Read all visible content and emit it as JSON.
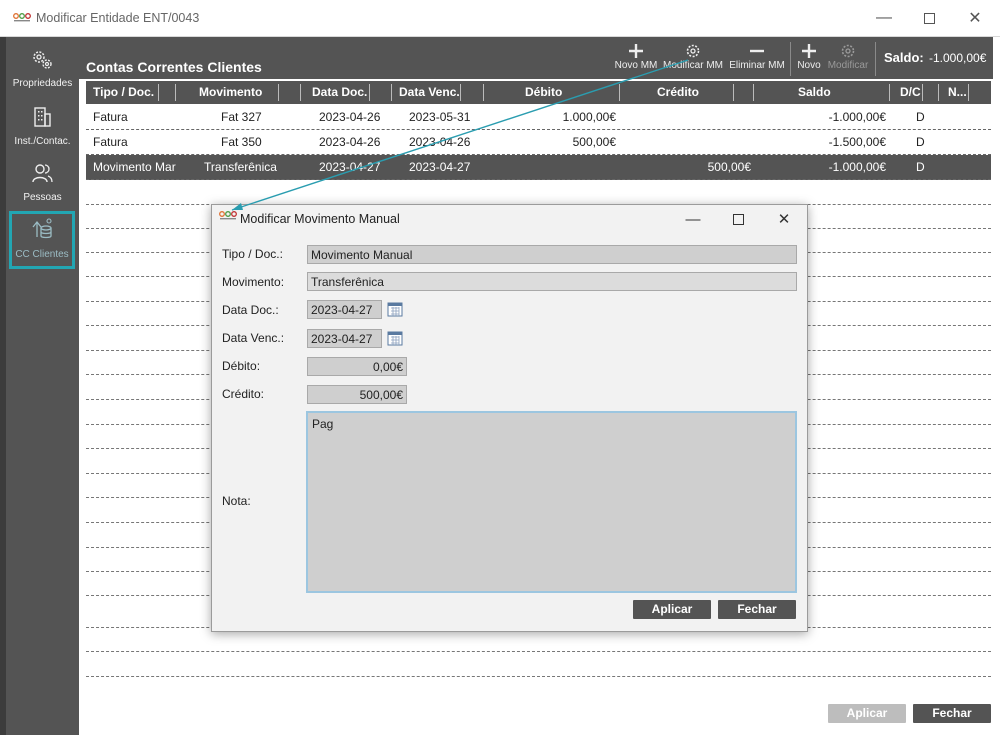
{
  "window": {
    "title": "Modificar Entidade ENT/0043"
  },
  "sidebar": {
    "items": [
      {
        "label": "Propriedades",
        "icon": "gears-icon"
      },
      {
        "label": "Inst./Contac.",
        "icon": "building-icon"
      },
      {
        "label": "Pessoas",
        "icon": "people-icon"
      },
      {
        "label": "CC Clientes",
        "icon": "coins-icon",
        "active": true
      }
    ]
  },
  "panel": {
    "title": "Contas Correntes Clientes",
    "toolbar": {
      "novo_mm": "Novo MM",
      "modificar_mm": "Modificar MM",
      "eliminar_mm": "Eliminar MM",
      "novo": "Novo",
      "modificar": "Modificar"
    },
    "saldo_label": "Saldo:",
    "saldo_value": "-1.000,00€"
  },
  "table": {
    "columns": [
      "Tipo / Doc.",
      "Movimento",
      "Data Doc.",
      "Data Venc.",
      "Débito",
      "Crédito",
      "Saldo",
      "D/C",
      "N..."
    ],
    "rows": [
      {
        "tipo": "Fatura",
        "movimento": "Fat 327",
        "data_doc": "2023-04-26",
        "data_venc": "2023-05-31",
        "debito": "1.000,00€",
        "credito": "",
        "saldo": "-1.000,00€",
        "dc": "D"
      },
      {
        "tipo": "Fatura",
        "movimento": "Fat 350",
        "data_doc": "2023-04-26",
        "data_venc": "2023-04-26",
        "debito": "500,00€",
        "credito": "",
        "saldo": "-1.500,00€",
        "dc": "D"
      },
      {
        "tipo": "Movimento Mar",
        "movimento": "Transferênica",
        "data_doc": "2023-04-27",
        "data_venc": "2023-04-27",
        "debito": "",
        "credito": "500,00€",
        "saldo": "-1.000,00€",
        "dc": "D"
      }
    ]
  },
  "footer": {
    "aplicar": "Aplicar",
    "fechar": "Fechar"
  },
  "dialog": {
    "title": "Modificar Movimento Manual",
    "labels": {
      "tipo": "Tipo / Doc.:",
      "movimento": "Movimento:",
      "data_doc": "Data Doc.:",
      "data_venc": "Data Venc.:",
      "debito": "Débito:",
      "credito": "Crédito:",
      "nota": "Nota:"
    },
    "values": {
      "tipo": "Movimento Manual",
      "movimento": "Transferênica",
      "data_doc": "2023-04-27",
      "data_venc": "2023-04-27",
      "debito": "0,00€",
      "credito": "500,00€",
      "nota": "Pag"
    },
    "aplicar": "Aplicar",
    "fechar": "Fechar"
  },
  "colors": {
    "dark": "#545454",
    "accent": "#22a6b3",
    "field": "#cfcfcf"
  }
}
